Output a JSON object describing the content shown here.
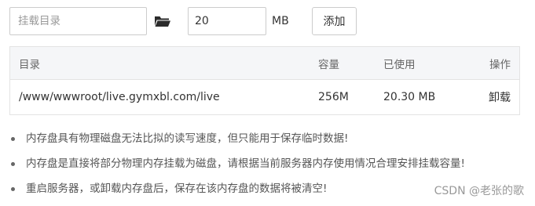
{
  "toolbar": {
    "dir_placeholder": "挂载目录",
    "folder_icon": "folder-open-icon",
    "size_value": "20",
    "unit": "MB",
    "add_label": "添加"
  },
  "table": {
    "headers": {
      "dir": "目录",
      "capacity": "容量",
      "used": "已使用",
      "operation": "操作"
    },
    "rows": [
      {
        "dir": "/www/wwwroot/live.gymxbl.com/live",
        "capacity": "256M",
        "used": "20.30 MB",
        "operation": "卸载"
      }
    ]
  },
  "notes": [
    "内存盘具有物理磁盘无法比拟的读写速度，但只能用于保存临时数据!",
    "内存盘是直接将部分物理内存挂载为磁盘，请根据当前服务器内存使用情况合理安排挂载容量!",
    "重启服务器，或卸载内存盘后，保存在该内存盘的数据将被清空!"
  ],
  "watermark": "CSDN @老张的歌",
  "colors": {
    "accent_green": "#20a53a",
    "header_bg": "#f5f6f8",
    "border": "#e3e3e3"
  }
}
